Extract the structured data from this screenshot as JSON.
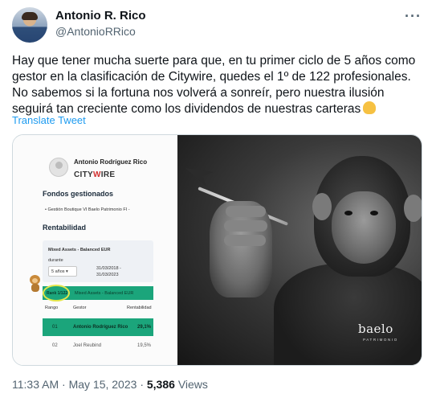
{
  "author": {
    "name": "Antonio R. Rico",
    "handle": "@AntonioRRico",
    "more_icon": "more-horizontal-icon"
  },
  "tweet": {
    "text": "Hay que tener mucha suerte para que, en tu primer ciclo de 5 años como gestor en la clasificación de Citywire, quedes el 1º de 122 profesionales. No sabemos si la fortuna nos volverá a sonreír, pero nuestra ilusión seguirá tan creciente como los dividendos de nuestras carteras",
    "emoji_icon": "flexed-biceps-icon",
    "translate": "Translate Tweet"
  },
  "media": {
    "card": {
      "profile_name": "Antonio Rodríguez Rico",
      "brand_pre": "CITY",
      "brand_w": "W",
      "brand_post": "IRE",
      "fondos_title": "Fondos gestionados",
      "fondo_item": "Gestión Boutique VI Baelo Patrimonio FI -",
      "rentabilidad_title": "Rentabilidad",
      "category": "Mixed Assets - Balanced EUR",
      "durante": "durante",
      "period_select": "5 años",
      "date_from": "31/03/2018 -",
      "date_to": "31/03/2023",
      "rank": "Rank 1/122",
      "rank_category": "Mixed Assets - Balanced EUR",
      "col_rango": "Rango",
      "col_gestor": "Gestor",
      "col_rentabilidad": "Rentabilidad",
      "rows": [
        {
          "rank": "01",
          "gestor": "Antonio Rodríguez Rico",
          "rent": "29,1%"
        },
        {
          "rank": "02",
          "gestor": "Joel Reubind",
          "rent": "19,5%"
        }
      ]
    },
    "photo": {
      "logo": "baelo",
      "logo_sub": "PATRIMONIO"
    }
  },
  "meta": {
    "time": "11:33 AM",
    "sep": "·",
    "date": "May 15, 2023",
    "sep2": "·",
    "views_count": "5,386",
    "views_label": "Views"
  }
}
